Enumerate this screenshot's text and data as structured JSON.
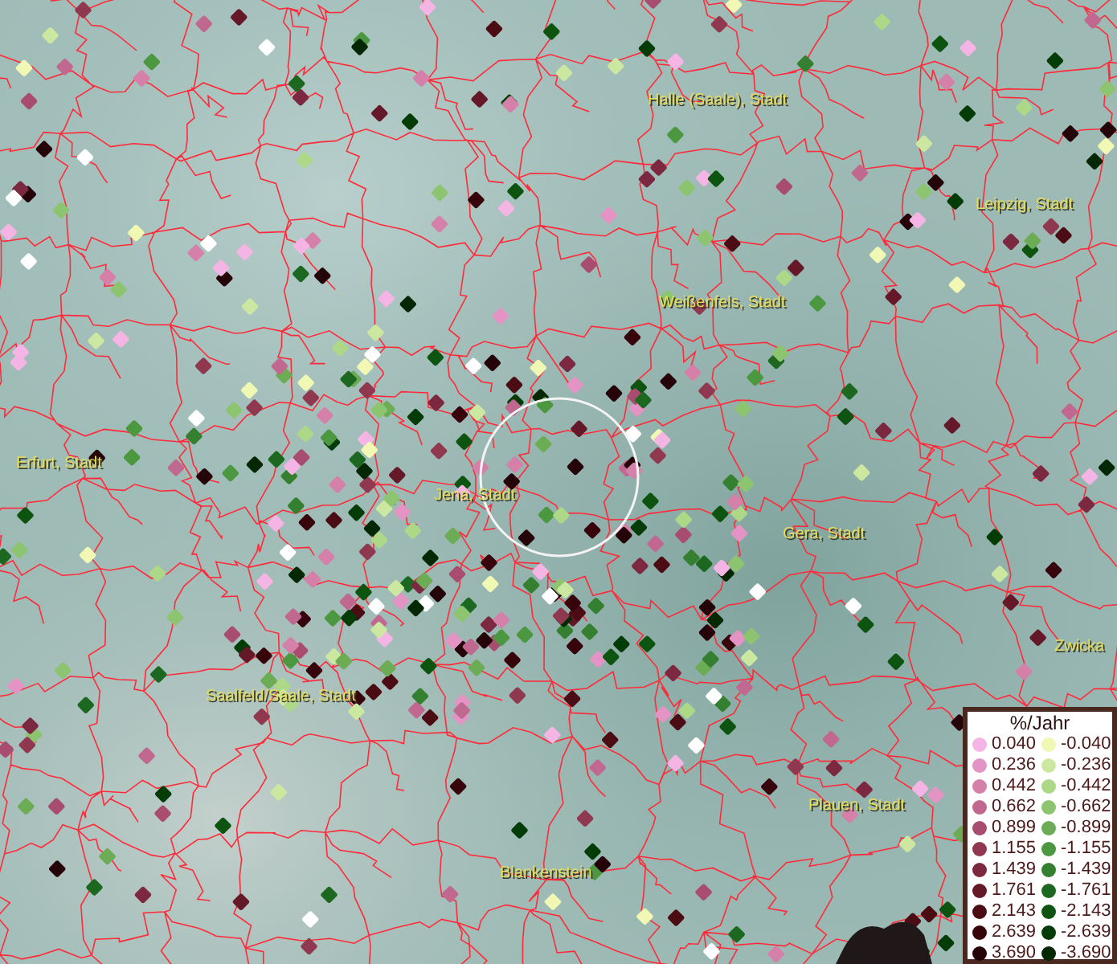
{
  "map": {
    "places": [
      {
        "name": "Halle (Saale), Stadt"
      },
      {
        "name": "Leipzig, Stadt"
      },
      {
        "name": "Weißenfels, Stadt"
      },
      {
        "name": "Erfurt, Stadt"
      },
      {
        "name": "Jena, Stadt"
      },
      {
        "name": "Gera, Stadt"
      },
      {
        "name": "Zwicka"
      },
      {
        "name": "Saalfeld/Saale, Stadt"
      },
      {
        "name": "Plauen, Stadt"
      },
      {
        "name": "Blankenstein"
      }
    ]
  },
  "legend": {
    "title": "%/Jahr",
    "increase_classes": [
      {
        "label": "0.040",
        "color": "#f4b4e4"
      },
      {
        "label": "0.236",
        "color": "#e494c4"
      },
      {
        "label": "0.442",
        "color": "#d480a8"
      },
      {
        "label": "0.662",
        "color": "#c06890"
      },
      {
        "label": "0.899",
        "color": "#a84c70"
      },
      {
        "label": "1.155",
        "color": "#903850"
      },
      {
        "label": "1.439",
        "color": "#7c2840"
      },
      {
        "label": "1.761",
        "color": "#641828"
      },
      {
        "label": "2.143",
        "color": "#4c0c14"
      },
      {
        "label": "2.639",
        "color": "#38040c"
      },
      {
        "label": "3.690",
        "color": "#240408"
      }
    ],
    "decrease_classes": [
      {
        "label": "-0.040",
        "color": "#f0f8b4"
      },
      {
        "label": "-0.236",
        "color": "#cce8a0"
      },
      {
        "label": "-0.442",
        "color": "#acd888"
      },
      {
        "label": "-0.662",
        "color": "#8cc470"
      },
      {
        "label": "-0.899",
        "color": "#6cac54"
      },
      {
        "label": "-1.155",
        "color": "#4c9840"
      },
      {
        "label": "-1.439",
        "color": "#348030"
      },
      {
        "label": "-1.761",
        "color": "#1c6820"
      },
      {
        "label": "-2.143",
        "color": "#0c5410"
      },
      {
        "label": "-2.639",
        "color": "#043c08"
      },
      {
        "label": "-3.690",
        "color": "#042804"
      }
    ]
  }
}
